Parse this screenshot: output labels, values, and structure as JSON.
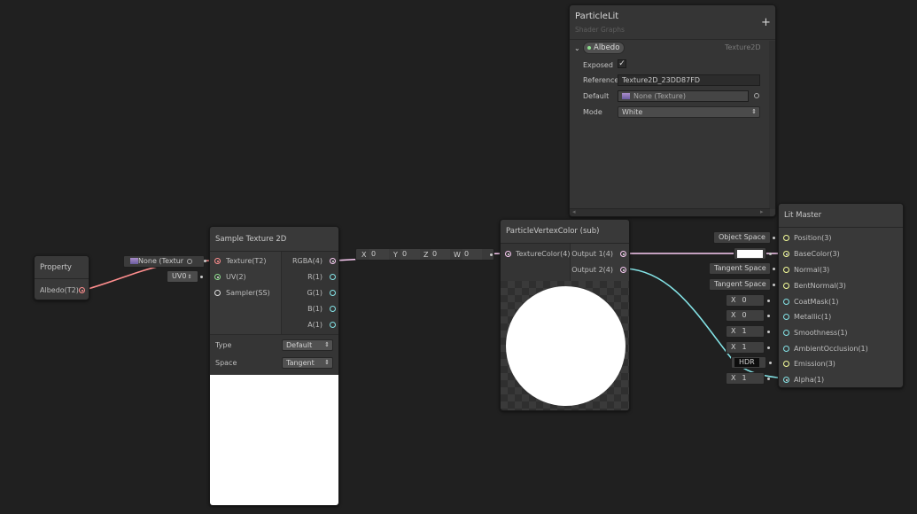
{
  "blackboard": {
    "title": "ParticleLit",
    "subtitle": "Shader Graphs",
    "add_label": "+",
    "property_name": "Albedo",
    "property_type": "Texture2D",
    "exposed_label": "Exposed",
    "exposed_check": "✓",
    "reference_label": "Reference",
    "reference_value": "Texture2D_23DD87FD",
    "default_label": "Default",
    "default_value": "None (Texture)",
    "mode_label": "Mode",
    "mode_value": "White"
  },
  "property_node": {
    "title": "Property",
    "output_label": "Albedo(T2)"
  },
  "sample_node": {
    "title": "Sample Texture 2D",
    "inline_texture": "None (Textur",
    "inline_uv": "UV0",
    "inputs": [
      "Texture(T2)",
      "UV(2)",
      "Sampler(SS)"
    ],
    "outputs": [
      "RGBA(4)",
      "R(1)",
      "G(1)",
      "B(1)",
      "A(1)"
    ],
    "type_label": "Type",
    "type_value": "Default",
    "space_label": "Space",
    "space_value": "Tangent"
  },
  "vector_inline": {
    "x_label": "X",
    "x_value": "0",
    "y_label": "Y",
    "y_value": "0",
    "z_label": "Z",
    "z_value": "0",
    "w_label": "W",
    "w_value": "0"
  },
  "vertex_color_node": {
    "title": "ParticleVertexColor (sub)",
    "input": "TextureColor(4)",
    "outputs": [
      "Output 1(4)",
      "Output 2(4)"
    ]
  },
  "master_node": {
    "title": "Lit Master",
    "ports": [
      "Position(3)",
      "BaseColor(3)",
      "Normal(3)",
      "BentNormal(3)",
      "CoatMask(1)",
      "Metallic(1)",
      "Smoothness(1)",
      "AmbientOcclusion(1)",
      "Emission(3)",
      "Alpha(1)"
    ],
    "inline": {
      "position": "Object Space",
      "normal": "Tangent Space",
      "bent_normal": "Tangent Space",
      "coatmask_x": "X",
      "coatmask_v": "0",
      "metallic_x": "X",
      "metallic_v": "0",
      "smoothness_x": "X",
      "smoothness_v": "1",
      "ao_x": "X",
      "ao_v": "1",
      "emission": "HDR",
      "alpha_x": "X",
      "alpha_v": "1"
    }
  },
  "colors": {
    "texture_port": "#ff8e8e",
    "uv_port": "#8ee08e",
    "vector1_port": "#84e4e7",
    "vector3_port": "#f6ff9a",
    "vector4_port": "#fbcbf4"
  }
}
